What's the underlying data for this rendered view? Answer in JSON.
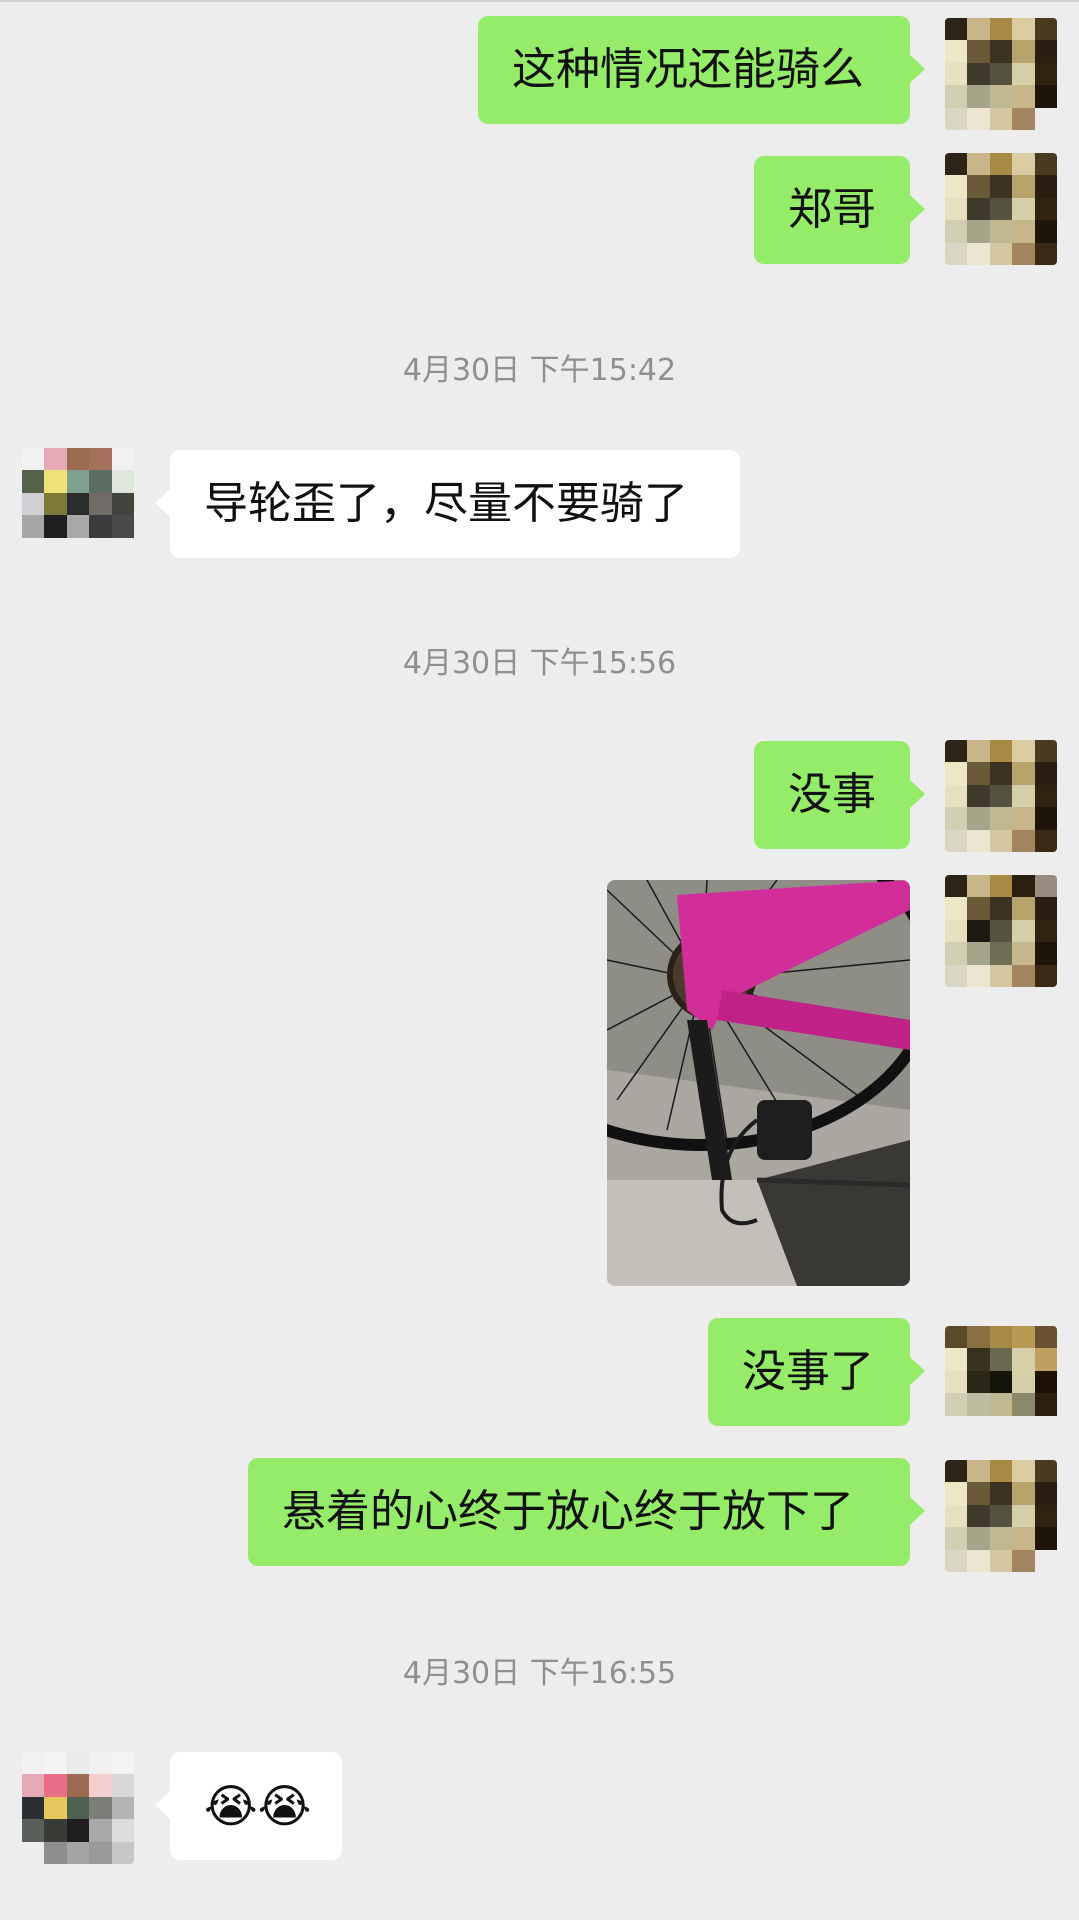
{
  "chat": {
    "messages": [
      {
        "text": "这种情况还能骑么"
      },
      {
        "text": "郑哥"
      },
      {
        "text": "导轮歪了，尽量不要骑了"
      },
      {
        "text": "没事"
      },
      {
        "text": "没事了"
      },
      {
        "text": "悬着的心终于放心终于放下了"
      },
      {
        "text": "😭😭"
      }
    ],
    "timestamps": [
      "4月30日 下午15:42",
      "4月30日 下午15:56",
      "4月30日 下午16:55"
    ]
  },
  "colors": {
    "background": "#ededed",
    "outgoing_bubble": "#95ec69",
    "incoming_bubble": "#ffffff",
    "timestamp": "#8f8f8f"
  }
}
